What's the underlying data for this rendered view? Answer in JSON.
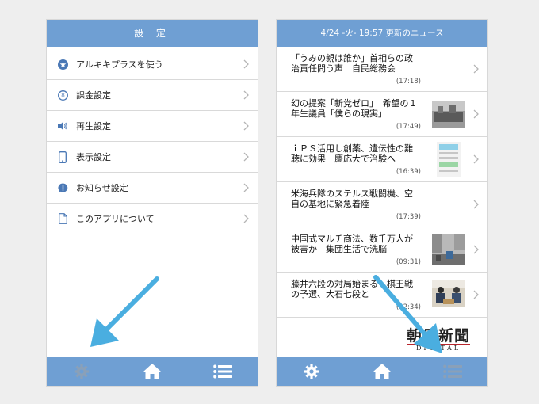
{
  "settings_screen": {
    "title": "設 定",
    "items": [
      {
        "label": "アルキキプラスを使う",
        "icon": "star-circle-icon"
      },
      {
        "label": "課金設定",
        "icon": "yen-circle-icon"
      },
      {
        "label": "再生設定",
        "icon": "speaker-icon"
      },
      {
        "label": "表示設定",
        "icon": "smartphone-icon"
      },
      {
        "label": "お知らせ設定",
        "icon": "exclamation-bubble-icon"
      },
      {
        "label": "このアプリについて",
        "icon": "document-icon"
      }
    ]
  },
  "news_screen": {
    "header": "4/24 -火- 19:57 更新のニュース",
    "items": [
      {
        "title": "「うみの親は誰か」首相らの政治責任問う声　自民総務会",
        "time": "(17:18)",
        "thumb": false
      },
      {
        "title": "幻の提案「新党ゼロ」　希望の１年生議員「僕らの現実」",
        "time": "(17:49)",
        "thumb": true
      },
      {
        "title": "ｉＰＳ活用し創薬、遺伝性の難聴に効果　慶応大で治験へ",
        "time": "(16:39)",
        "thumb": true
      },
      {
        "title": "米海兵隊のステルス戦闘機、空自の基地に緊急着陸",
        "time": "(17:39)",
        "thumb": false
      },
      {
        "title": "中国式マルチ商法、数千万人が被害か　集団生活で洗脳",
        "time": "(09:31)",
        "thumb": true
      },
      {
        "title": "藤井六段の対局始まる　棋王戦の予選、大石七段と",
        "time": "(12:34)",
        "thumb": true
      }
    ],
    "logo_main": "朝日新聞",
    "logo_sub": "DIGITAL"
  },
  "tabbar": {
    "tabs": [
      "settings-gear-icon",
      "home-icon",
      "list-icon"
    ]
  },
  "colors": {
    "header_blue": "#6f9fd3",
    "arrow_blue": "#4aaee0",
    "inactive_tab": "#8aa0b8"
  }
}
